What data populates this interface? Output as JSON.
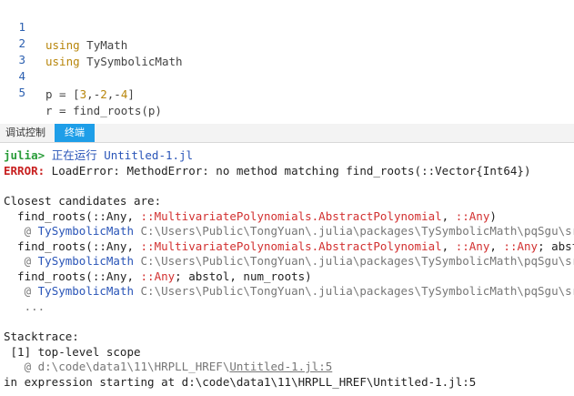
{
  "editor": {
    "lines": [
      {
        "num": "1",
        "kw": "using",
        "rest": " TyMath"
      },
      {
        "num": "2",
        "kw": "using",
        "rest": " TySymbolicMath"
      },
      {
        "num": "3"
      },
      {
        "num": "4",
        "a": "p = [",
        "n1": "3",
        "s1": ",-",
        "n2": "2",
        "s2": ",-",
        "n3": "4",
        "s3": "]"
      },
      {
        "num": "5",
        "a": "r = find_roots(p)"
      }
    ]
  },
  "tabs": {
    "debug_console": "调试控制台",
    "terminal": "终端"
  },
  "terminal": {
    "prompt": "julia>",
    "running_label": "正在运行",
    "running_file": "Untitled-1.jl",
    "error_tag": "ERROR:",
    "error_msg": " LoadError: MethodError: no method matching find_roots(::Vector{Int64})",
    "closest": "Closest candidates are:",
    "c1_a": "  find_roots(::Any, ",
    "c1_b": "::MultivariatePolynomials.AbstractPolynomial",
    "c1_c": ", ",
    "c1_d": "::Any",
    "c1_e": ")",
    "at_prefix": "   @ ",
    "pkg": "TySymbolicMath",
    "pkg_path": " C:\\Users\\Public\\TongYuan\\.julia\\packages\\TySymbolicMath\\pqSgu\\src\\",
    "c2_a": "  find_roots(::Any, ",
    "c2_b": "::MultivariatePolynomials.AbstractPolynomial",
    "c2_c": ", ",
    "c2_d": "::Any",
    "c2_e": ", ",
    "c2_f": "::Any",
    "c2_g": "; abstol",
    "c3_a": "  find_roots(::Any, ",
    "c3_b": "::Any",
    "c3_c": "; abstol, num_roots)",
    "ellipsis": "   ...",
    "stacktrace": "Stacktrace:",
    "frame": " [1] top-level scope",
    "frame_at": "   @ d:\\code\\data1\\11\\HRPLL_HREF\\",
    "frame_file": "Untitled-1.jl:5",
    "in_expr": "in expression starting at d:\\code\\data1\\11\\HRPLL_HREF\\Untitled-1.jl:5"
  }
}
